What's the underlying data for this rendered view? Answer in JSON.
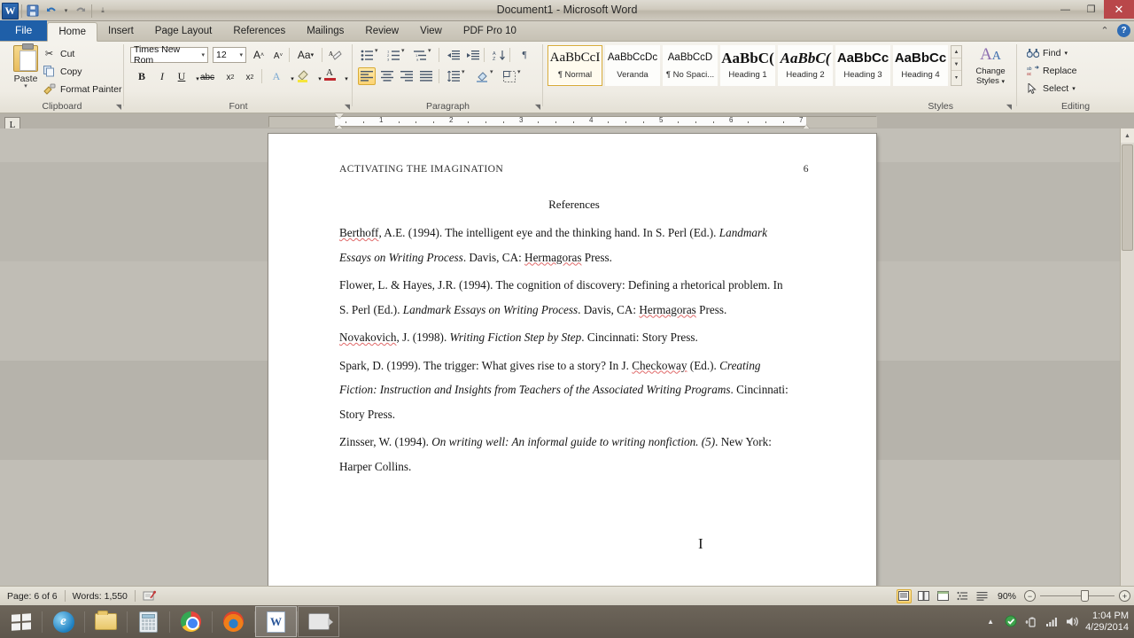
{
  "window": {
    "title": "Document1 - Microsoft Word",
    "quick_access": [
      "word-logo",
      "save-icon",
      "undo-icon",
      "undo-dropdown",
      "redo-icon",
      "qat-customize"
    ],
    "controls": {
      "minimize": "—",
      "maximize": "❐",
      "close": "✕"
    }
  },
  "ribbon": {
    "tabs": [
      {
        "label": "File",
        "type": "file"
      },
      {
        "label": "Home",
        "active": true
      },
      {
        "label": "Insert"
      },
      {
        "label": "Page Layout"
      },
      {
        "label": "References"
      },
      {
        "label": "Mailings"
      },
      {
        "label": "Review"
      },
      {
        "label": "View"
      },
      {
        "label": "PDF Pro 10"
      }
    ],
    "right_icons": [
      "collapse-ribbon-icon",
      "help-icon"
    ],
    "clipboard": {
      "label": "Clipboard",
      "paste": "Paste",
      "items": [
        {
          "label": "Cut",
          "icon": "scissors-icon"
        },
        {
          "label": "Copy",
          "icon": "copy-icon"
        },
        {
          "label": "Format Painter",
          "icon": "paintbrush-icon"
        }
      ]
    },
    "font": {
      "label": "Font",
      "family": "Times New Rom",
      "size": "12",
      "buttons": [
        "grow-font-icon",
        "shrink-font-icon",
        "change-case-icon",
        "clear-formatting-icon",
        "bold-icon",
        "italic-icon",
        "underline-icon",
        "strikethrough-icon",
        "subscript-icon",
        "superscript-icon",
        "text-effects-icon",
        "highlight-color-icon",
        "font-color-icon"
      ]
    },
    "paragraph": {
      "label": "Paragraph",
      "buttons": [
        "bullets-icon",
        "numbering-icon",
        "multilevel-list-icon",
        "decrease-indent-icon",
        "increase-indent-icon",
        "sort-icon",
        "show-marks-icon",
        "align-left-icon",
        "align-center-icon",
        "align-right-icon",
        "justify-icon",
        "line-spacing-icon",
        "shading-icon",
        "borders-icon"
      ],
      "active": "align-left-icon"
    },
    "styles": {
      "label": "Styles",
      "gallery": [
        {
          "preview": "AaBbCcI",
          "name": "¶ Normal",
          "selected": true,
          "style": "serif-normal"
        },
        {
          "preview": "AaBbCcDc",
          "name": "Veranda",
          "style": "sans-small"
        },
        {
          "preview": "AaBbCcD",
          "name": "¶ No Spaci...",
          "style": "sans-small"
        },
        {
          "preview": "AaBbC(",
          "name": "Heading 1",
          "style": "bold-serif"
        },
        {
          "preview": "AaBbC(",
          "name": "Heading 2",
          "style": "bold-italic-serif"
        },
        {
          "preview": "AaBbCc",
          "name": "Heading 3",
          "style": "bold-sans"
        },
        {
          "preview": "AaBbCc",
          "name": "Heading 4",
          "style": "bold-sans"
        }
      ],
      "change_styles": "Change\nStyles",
      "change_styles_line1": "Change",
      "change_styles_line2": "Styles",
      "scroll": [
        "scroll-up-icon",
        "scroll-down-icon",
        "more-styles-icon"
      ]
    },
    "editing": {
      "label": "Editing",
      "items": [
        {
          "label": "Find",
          "icon": "binoculars-icon",
          "dropdown": true
        },
        {
          "label": "Replace",
          "icon": "replace-icon"
        },
        {
          "label": "Select",
          "icon": "select-pointer-icon",
          "dropdown": true
        }
      ]
    }
  },
  "ruler": {
    "tab_stop_selector": "L",
    "numbers": [
      "1",
      "2",
      "3",
      "4",
      "5",
      "6",
      "7"
    ]
  },
  "document": {
    "header_left": "ACTIVATING  THE  IMAGINATION",
    "header_right": "6",
    "references_title": "References",
    "entries": [
      {
        "lines": [
          [
            {
              "t": "Berthoff",
              "s": "spell"
            },
            {
              "t": ", A.E. (1994). The intelligent eye and the thinking hand.  In S. Perl (Ed.). "
            },
            {
              "t": "Landmark",
              "s": "italic"
            }
          ],
          [
            {
              "t": "Essays  on  Writing  Process",
              "s": "italic"
            },
            {
              "t": ". Davis, CA: "
            },
            {
              "t": "Hermagoras",
              "s": "spell"
            },
            {
              "t": " Press."
            }
          ]
        ]
      },
      {
        "lines": [
          [
            {
              "t": "Flower, L. & Hayes, J.R. (1994). The cognition of discovery: Defining a rhetorical problem. In"
            }
          ],
          [
            {
              "t": "S. Perl (Ed.). "
            },
            {
              "t": "Landmark Essays on Writing Process",
              "s": "italic"
            },
            {
              "t": ". Davis, CA: "
            },
            {
              "t": "Hermagoras",
              "s": "spell"
            },
            {
              "t": " Press."
            }
          ]
        ]
      },
      {
        "lines": [
          [
            {
              "t": "Novakovich",
              "s": "spell"
            },
            {
              "t": ", J. (1998). "
            },
            {
              "t": "Writing Fiction Step by Step",
              "s": "italic"
            },
            {
              "t": ".  Cincinnati: Story Press."
            }
          ]
        ]
      },
      {
        "lines": [
          [
            {
              "t": "Spark, D. (1999). The trigger: What gives rise to a story? In J. "
            },
            {
              "t": "Checkoway",
              "s": "spell"
            },
            {
              "t": " (Ed.).  "
            },
            {
              "t": "Creating",
              "s": "italic"
            }
          ],
          [
            {
              "t": "Fiction: Instruction and Insights from Teachers of the Associated Writing Programs",
              "s": "italic"
            },
            {
              "t": ". Cincinnati:"
            }
          ],
          [
            {
              "t": "Story Press."
            }
          ]
        ]
      },
      {
        "lines": [
          [
            {
              "t": "Zinsser, W. (1994).  "
            },
            {
              "t": "On writing well:  An informal guide to writing nonfiction.  (5)",
              "s": "italic"
            },
            {
              "t": ". New York:"
            }
          ],
          [
            {
              "t": "Harper Collins."
            }
          ]
        ]
      }
    ]
  },
  "status_bar": {
    "page": "Page: 6 of 6",
    "words": "Words: 1,550",
    "proofing_icon": "proofing-errors-icon",
    "view_buttons": [
      {
        "name": "print-layout-view",
        "glyph": "▤",
        "active": true
      },
      {
        "name": "full-screen-reading-view",
        "glyph": "⛶"
      },
      {
        "name": "web-layout-view",
        "glyph": "⊞"
      },
      {
        "name": "outline-view",
        "glyph": "⋮≡"
      },
      {
        "name": "draft-view",
        "glyph": "≣"
      }
    ],
    "zoom": "90%",
    "zoom_out": "−",
    "zoom_in": "+"
  },
  "taskbar": {
    "start": "windows-start-icon",
    "apps": [
      {
        "name": "internet-explorer",
        "icon": "ie-icon"
      },
      {
        "name": "file-explorer",
        "icon": "folder-icon"
      },
      {
        "name": "calculator",
        "icon": "calculator-icon"
      },
      {
        "name": "google-chrome",
        "icon": "chrome-icon"
      },
      {
        "name": "mozilla-firefox",
        "icon": "firefox-icon"
      },
      {
        "name": "microsoft-word",
        "icon": "word-icon",
        "active": true
      },
      {
        "name": "screen-recorder",
        "icon": "camera-icon"
      }
    ],
    "tray": [
      "show-hidden-icons",
      "antivirus-icon",
      "power-icon",
      "network-icon",
      "volume-icon"
    ],
    "time": "1:04 PM",
    "date": "4/29/2014"
  },
  "colors": {
    "file_tab": "#1f5fa8",
    "close_button": "#b9474a",
    "accent_gold": "#d8ab36",
    "spell_error": "#e06a6a"
  }
}
